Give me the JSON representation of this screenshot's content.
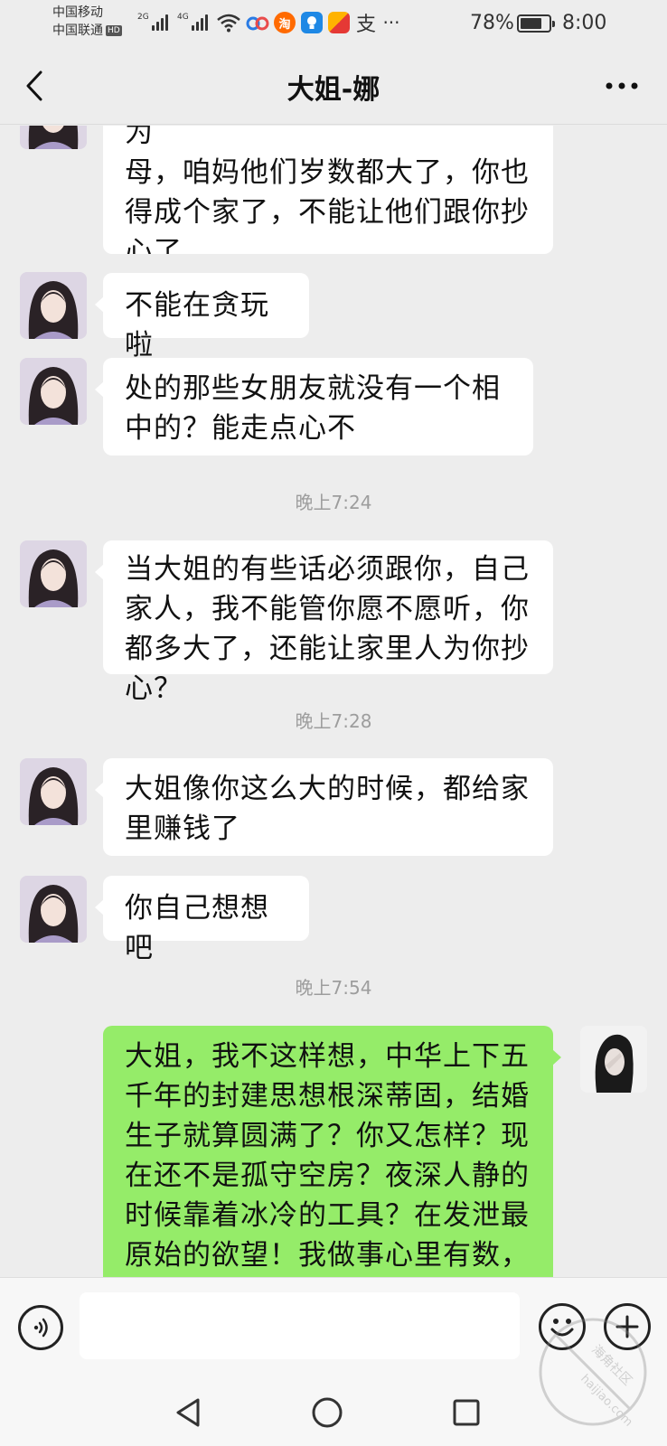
{
  "status_bar": {
    "carrier_1": "中国移动",
    "carrier_2": "中国联通",
    "hd_badge": "HD",
    "signal_1_tag": "2G",
    "signal_2_tag": "4G",
    "icons": [
      "wifi-icon",
      "baidu-netdisk-icon",
      "taobao-icon",
      "bulb-app-icon",
      "folder-app-icon",
      "alipay-icon",
      "more-dots-icon"
    ],
    "app_glyphs": {
      "taobao": "淘",
      "alipay": "支",
      "more": "···"
    },
    "battery_percent_text": "78%",
    "battery_level": 0.78,
    "time": "8:00"
  },
  "header": {
    "title": "大姐-娜",
    "back_icon": "chevron-left-icon",
    "more_icon": "ellipsis-icon"
  },
  "messages": [
    {
      "type": "in",
      "text": "母，咱妈他们岁数都大了，你也得成个家了，不能让他们跟你抄心了，",
      "partial_top_line": "有句话说得好，长兄为父，长姐为"
    },
    {
      "type": "in",
      "text": "不能在贪玩啦"
    },
    {
      "type": "in",
      "text": "处的那些女朋友就没有一个相中的？能走点心不"
    },
    {
      "type": "time",
      "text": "晚上7:24"
    },
    {
      "type": "in",
      "text": "当大姐的有些话必须跟你，自己家人，我不能管你愿不愿听，你都多大了，还能让家里人为你抄心？"
    },
    {
      "type": "time",
      "text": "晚上7:28"
    },
    {
      "type": "in",
      "text": "大姐像你这么大的时候，都给家里赚钱了"
    },
    {
      "type": "in",
      "text": "你自己想想吧"
    },
    {
      "type": "time",
      "text": "晚上7:54"
    },
    {
      "type": "out",
      "text": "大姐，我不这样想，中华上下五千年的封建思想根深蒂固，结婚生子就算圆满了？你又怎样？现在还不是孤守空房？夜深人静的时候靠着冰冷的工具？在发泄最原始的欲望！我做事心里有数，从小我都听"
    }
  ],
  "input_bar": {
    "message_value": "",
    "voice_icon": "voice-input-icon",
    "emoji_icon": "emoji-icon",
    "plus_icon": "plus-icon"
  },
  "nav_bar": {
    "icons": [
      "back-triangle-icon",
      "home-circle-icon",
      "recents-square-icon"
    ]
  },
  "watermark": {
    "site_text": "海角社区",
    "url_text": "haijiao.com"
  },
  "colors": {
    "background": "#ededed",
    "incoming_bubble": "#ffffff",
    "outgoing_bubble": "#95ec69",
    "timestamp": "#9d9d9d"
  }
}
